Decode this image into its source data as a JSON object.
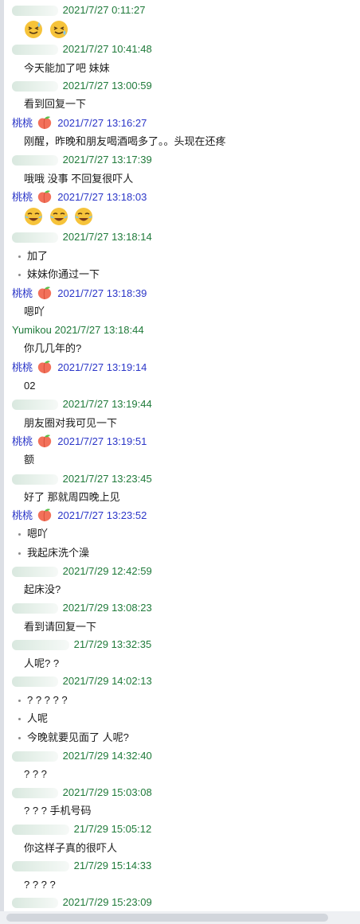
{
  "chat": {
    "messages": [
      {
        "sender": "",
        "sender_color": "green",
        "time": "2021/7/27 0:11:27",
        "lines": [],
        "emoji": [
          "sweat-smile",
          "sweat-smile"
        ]
      },
      {
        "sender": "",
        "sender_color": "green",
        "time": "2021/7/27 10:41:48",
        "lines": [
          "今天能加了吧 妹妹"
        ]
      },
      {
        "sender": "",
        "sender_color": "green",
        "time": "2021/7/27 13:00:59",
        "lines": [
          "看到回复一下"
        ]
      },
      {
        "sender": "桃桃",
        "sender_color": "blue",
        "peach": true,
        "time": "2021/7/27 13:16:27",
        "lines": [
          "刚醒，昨晚和朋友喝酒喝多了。。头现在还疼"
        ]
      },
      {
        "sender": "",
        "sender_color": "green",
        "time": "2021/7/27 13:17:39",
        "lines": [
          "哦哦 没事 不回复很吓人"
        ]
      },
      {
        "sender": "桃桃",
        "sender_color": "blue",
        "peach": true,
        "time": "2021/7/27 13:18:03",
        "lines": [],
        "emoji": [
          "crying-laugh",
          "crying-laugh",
          "crying-laugh"
        ]
      },
      {
        "sender": "",
        "sender_color": "green",
        "time": "2021/7/27 13:18:14",
        "bullets": [
          "加了",
          "妹妹你通过一下"
        ]
      },
      {
        "sender": "桃桃",
        "sender_color": "blue",
        "peach": true,
        "time": "2021/7/27 13:18:39",
        "lines": [
          "嗯吖"
        ]
      },
      {
        "sender": "Yumikou",
        "sender_color": "green",
        "time": "2021/7/27 13:18:44",
        "lines": [
          "你几几年的?"
        ]
      },
      {
        "sender": "桃桃",
        "sender_color": "blue",
        "peach": true,
        "time": "2021/7/27 13:19:14",
        "lines": [
          "02"
        ]
      },
      {
        "sender": "",
        "sender_color": "green",
        "time": "2021/7/27 13:19:44",
        "lines": [
          "朋友圈对我可见一下"
        ]
      },
      {
        "sender": "桃桃",
        "sender_color": "blue",
        "peach": true,
        "time": "2021/7/27 13:19:51",
        "lines": [
          "额"
        ]
      },
      {
        "sender": "",
        "sender_color": "green",
        "time": "2021/7/27 13:23:45",
        "lines": [
          "好了 那就周四晚上见"
        ]
      },
      {
        "sender": "桃桃",
        "sender_color": "blue",
        "peach": true,
        "time": "2021/7/27 13:23:52",
        "bullets": [
          "嗯吖",
          "我起床洗个澡"
        ]
      },
      {
        "sender": "",
        "sender_color": "green",
        "time": "2021/7/29 12:42:59",
        "lines": [
          "起床没?"
        ]
      },
      {
        "sender": "",
        "sender_color": "green",
        "time": "2021/7/29 13:08:23",
        "lines": [
          "看到请回复一下"
        ]
      },
      {
        "sender": "",
        "sender_color": "green",
        "time": "21/7/29 13:32:35",
        "lines": [
          "人呢? ?"
        ]
      },
      {
        "sender": "",
        "sender_color": "green",
        "time": "2021/7/29 14:02:13",
        "bullets": [
          "? ? ? ? ?",
          "人呢",
          "今晚就要见面了 人呢?"
        ]
      },
      {
        "sender": "",
        "sender_color": "green",
        "time": "2021/7/29 14:32:40",
        "lines": [
          "? ? ?"
        ]
      },
      {
        "sender": "",
        "sender_color": "green",
        "time": "2021/7/29 15:03:08",
        "lines": [
          "? ? ?  手机号码"
        ]
      },
      {
        "sender": "",
        "sender_color": "green",
        "time": "21/7/29 15:05:12",
        "lines": [
          "你这样子真的很吓人"
        ]
      },
      {
        "sender": "",
        "sender_color": "green",
        "time": "21/7/29 15:14:33",
        "lines": [
          "? ? ? ?"
        ]
      },
      {
        "sender": "",
        "sender_color": "green",
        "time": "2021/7/29 15:23:09",
        "lines": []
      }
    ]
  },
  "colors": {
    "time_green": "#1f7a3a",
    "time_blue": "#2b36c8",
    "text": "#1a1a1a"
  }
}
